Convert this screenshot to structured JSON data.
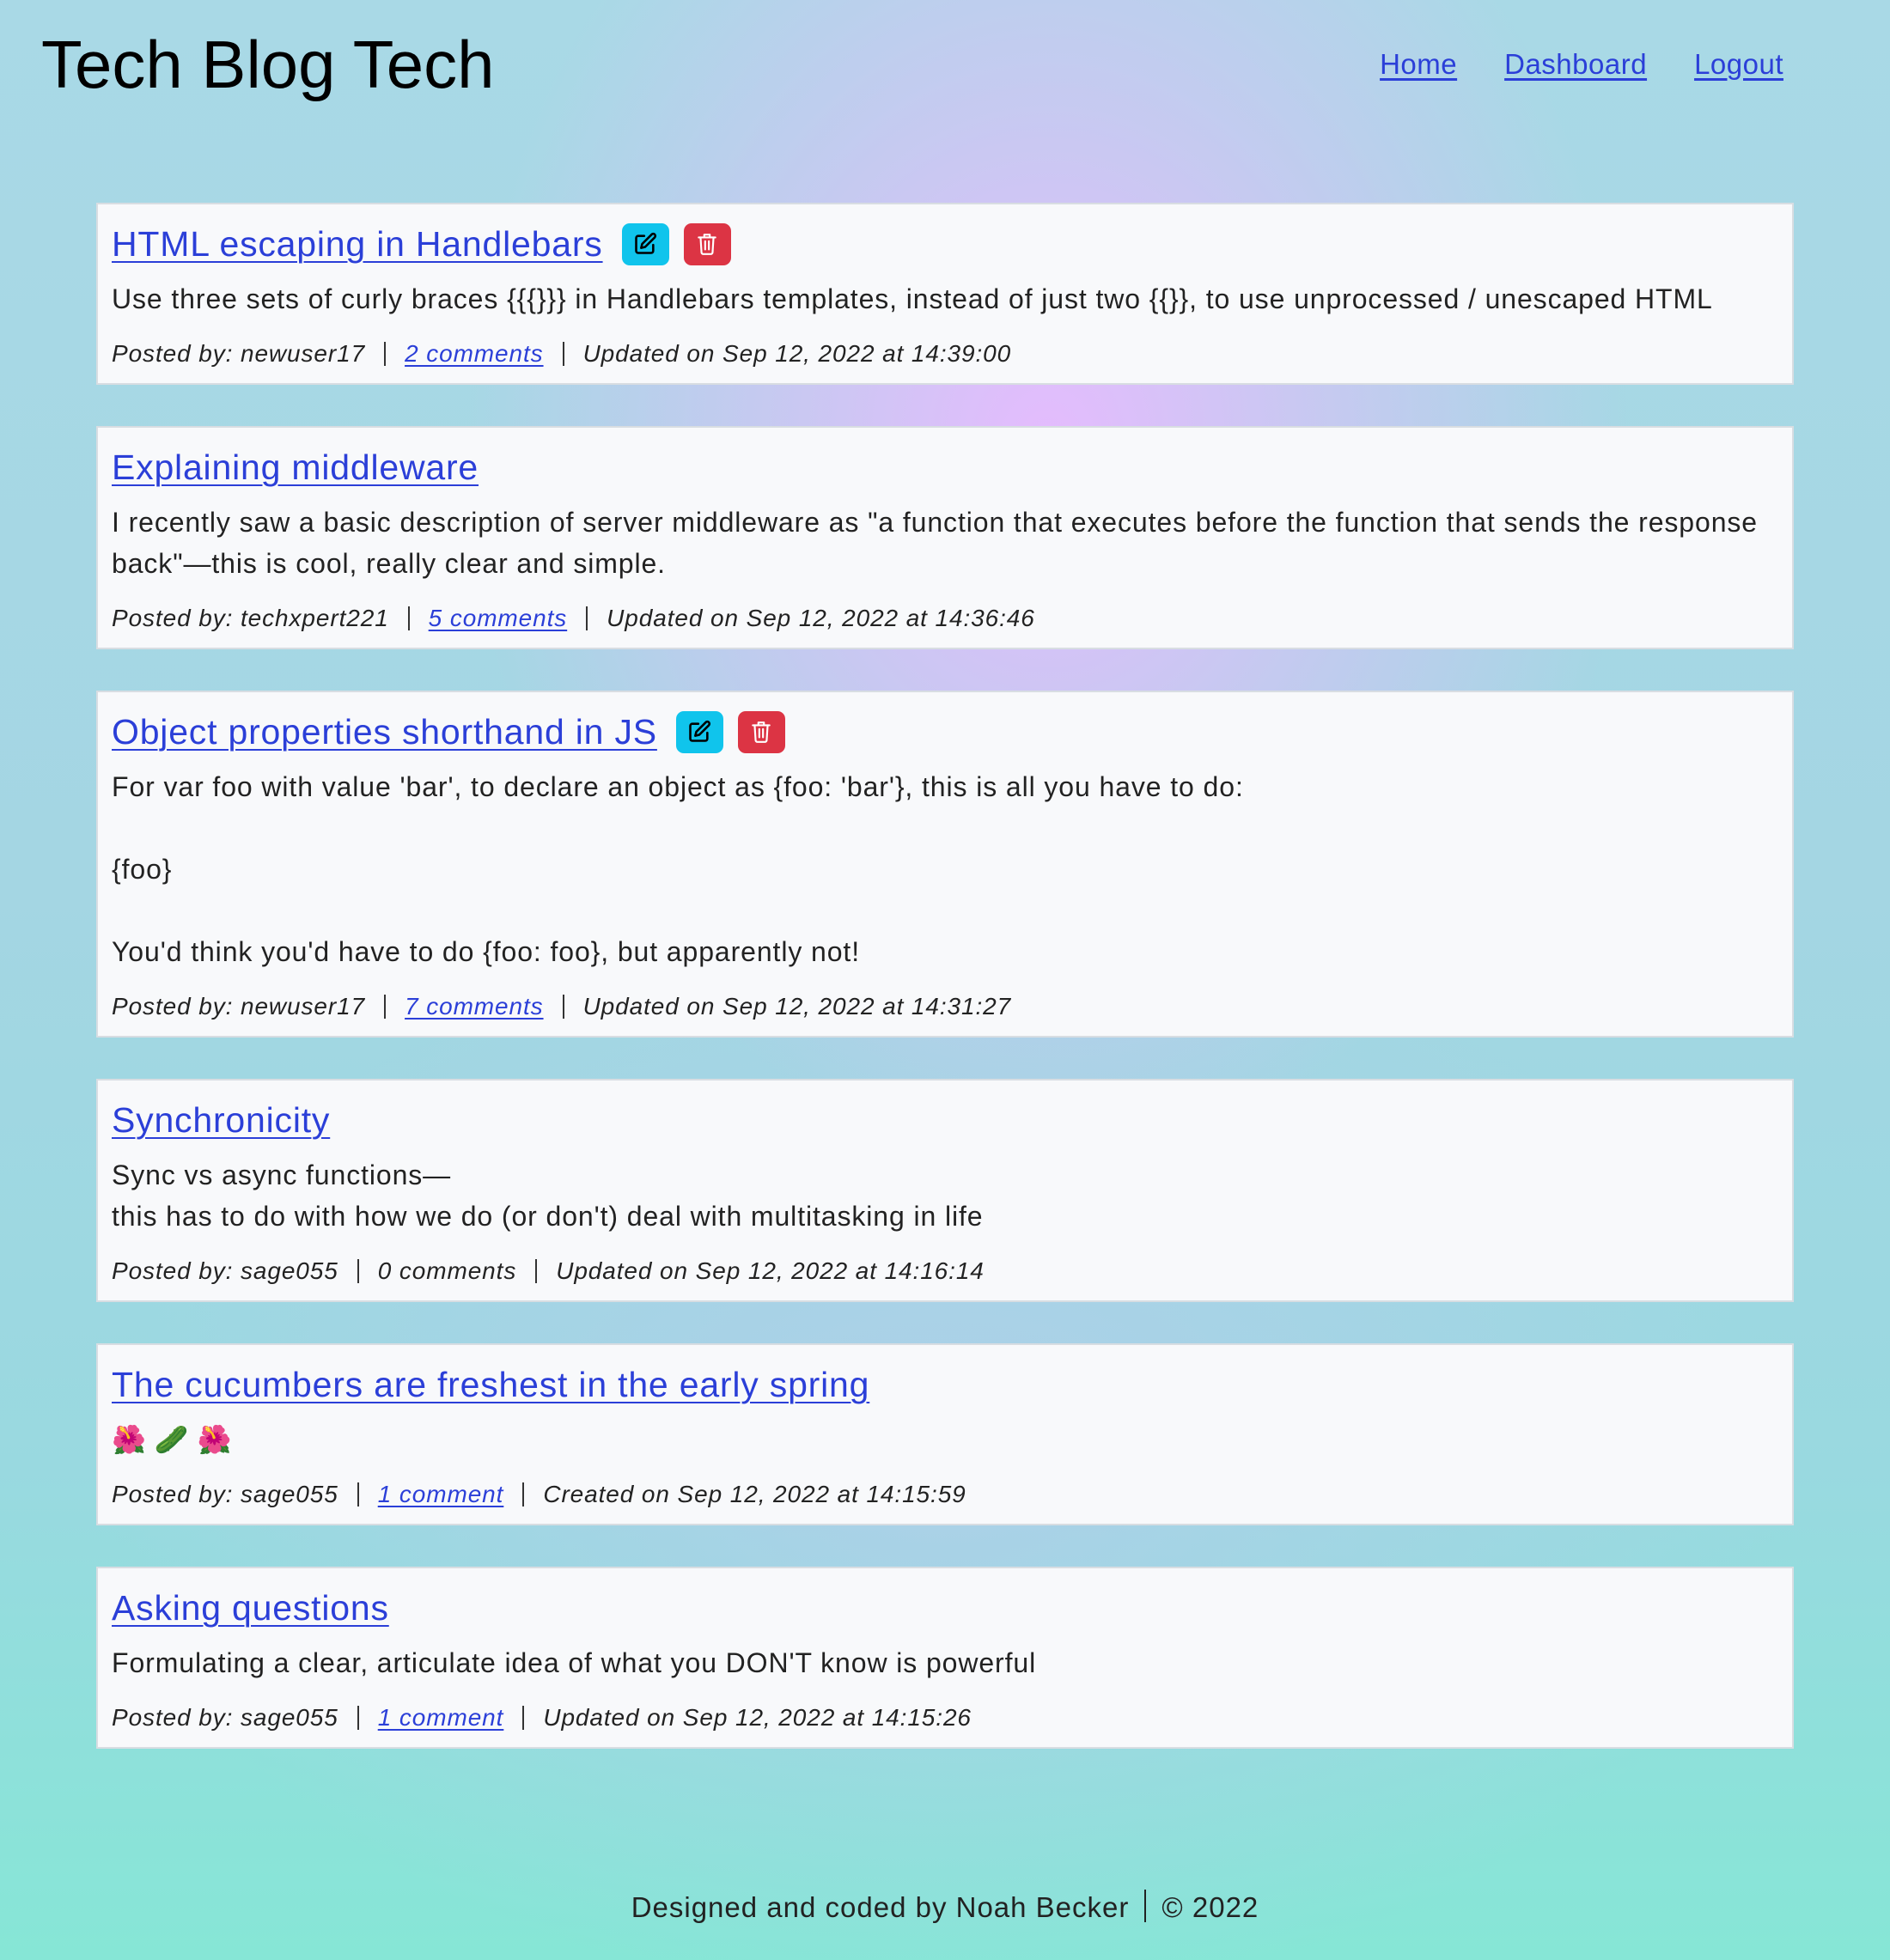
{
  "site": {
    "title": "Tech Blog Tech"
  },
  "nav": {
    "home": "Home",
    "dashboard": "Dashboard",
    "logout": "Logout"
  },
  "posts": [
    {
      "title": "HTML escaping in Handlebars",
      "editable": true,
      "body": "Use three sets of curly braces {{{}}} in Handlebars templates, instead of just two {{}}, to use unprocessed / unescaped HTML",
      "posted_by": "Posted by: newuser17",
      "comments": "2 comments",
      "comments_link": true,
      "date": "Updated on Sep 12, 2022 at 14:39:00"
    },
    {
      "title": "Explaining middleware",
      "editable": false,
      "body": "I recently saw a basic description of server middleware as \"a function that executes before the function that sends the response back\"—this is cool, really clear and simple.",
      "posted_by": "Posted by: techxpert221",
      "comments": "5 comments",
      "comments_link": true,
      "date": "Updated on Sep 12, 2022 at 14:36:46"
    },
    {
      "title": "Object properties shorthand in JS",
      "editable": true,
      "body": "For var foo with value 'bar', to declare an object as {foo: 'bar'}, this is all you have to do:\n\n{foo}\n\nYou'd think you'd have to do {foo: foo}, but apparently not!",
      "posted_by": "Posted by: newuser17",
      "comments": "7 comments",
      "comments_link": true,
      "date": "Updated on Sep 12, 2022 at 14:31:27"
    },
    {
      "title": "Synchronicity",
      "editable": false,
      "body": "Sync vs async functions—\nthis has to do with how we do (or don't) deal with multitasking in life",
      "posted_by": "Posted by: sage055",
      "comments": "0 comments",
      "comments_link": false,
      "date": "Updated on Sep 12, 2022 at 14:16:14"
    },
    {
      "title": "The cucumbers are freshest in the early spring",
      "editable": false,
      "body": "🌺🥒🌺",
      "posted_by": "Posted by: sage055",
      "comments": "1 comment",
      "comments_link": true,
      "date": "Created on Sep 12, 2022 at 14:15:59"
    },
    {
      "title": "Asking questions",
      "editable": false,
      "body": "Formulating a clear, articulate idea of what you DON'T know is powerful",
      "posted_by": "Posted by: sage055",
      "comments": "1 comment",
      "comments_link": true,
      "date": "Updated on Sep 12, 2022 at 14:15:26"
    }
  ],
  "footer": {
    "credit": "Designed and coded by Noah Becker",
    "copyright": "© 2022"
  },
  "colors": {
    "link": "#2b3fd8",
    "edit_button": "#10c4ec",
    "delete_button": "#dc3444",
    "card_bg": "#f8f9fb"
  },
  "icons": {
    "edit": "edit-pencil-icon",
    "delete": "trash-icon"
  }
}
